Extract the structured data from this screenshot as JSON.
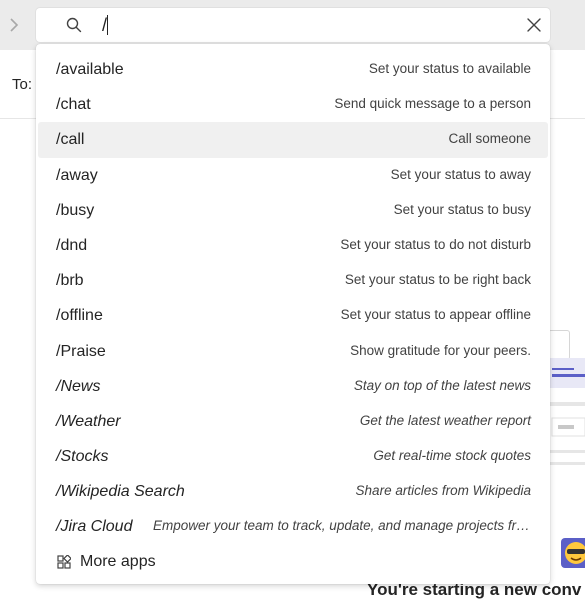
{
  "search": {
    "value": "/",
    "placeholder": ""
  },
  "page": {
    "to_label": "To:",
    "new_conversation_text": "You're starting a new conv"
  },
  "commands": [
    {
      "name": "/available",
      "description": "Set your status to available",
      "highlighted": false,
      "app": false
    },
    {
      "name": "/chat",
      "description": "Send quick message to a person",
      "highlighted": false,
      "app": false
    },
    {
      "name": "/call",
      "description": "Call someone",
      "highlighted": true,
      "app": false
    },
    {
      "name": "/away",
      "description": "Set your status to away",
      "highlighted": false,
      "app": false
    },
    {
      "name": "/busy",
      "description": "Set your status to busy",
      "highlighted": false,
      "app": false
    },
    {
      "name": "/dnd",
      "description": "Set your status to do not disturb",
      "highlighted": false,
      "app": false
    },
    {
      "name": "/brb",
      "description": "Set your status to be right back",
      "highlighted": false,
      "app": false
    },
    {
      "name": "/offline",
      "description": "Set your status to appear offline",
      "highlighted": false,
      "app": false
    },
    {
      "name": "/Praise",
      "description": "Show gratitude for your peers.",
      "highlighted": false,
      "app": false
    },
    {
      "name": "/News",
      "description": "Stay on top of the latest news",
      "highlighted": false,
      "app": true
    },
    {
      "name": "/Weather",
      "description": "Get the latest weather report",
      "highlighted": false,
      "app": true
    },
    {
      "name": "/Stocks",
      "description": "Get real-time stock quotes",
      "highlighted": false,
      "app": true
    },
    {
      "name": "/Wikipedia Search",
      "description": "Share articles from Wikipedia",
      "highlighted": false,
      "app": true
    },
    {
      "name": "/Jira Cloud",
      "description": "Empower your team to track, update, and manage projects from ...",
      "highlighted": false,
      "app": true
    }
  ],
  "more_apps": {
    "label": "More apps",
    "icon": "apps-grid-icon"
  },
  "icons": {
    "search": "search-icon",
    "close": "close-icon",
    "nav": "chevron-right-icon"
  },
  "colors": {
    "highlight": "#f0f0f0",
    "accent": "#5b5fc7",
    "text": "#242424"
  }
}
